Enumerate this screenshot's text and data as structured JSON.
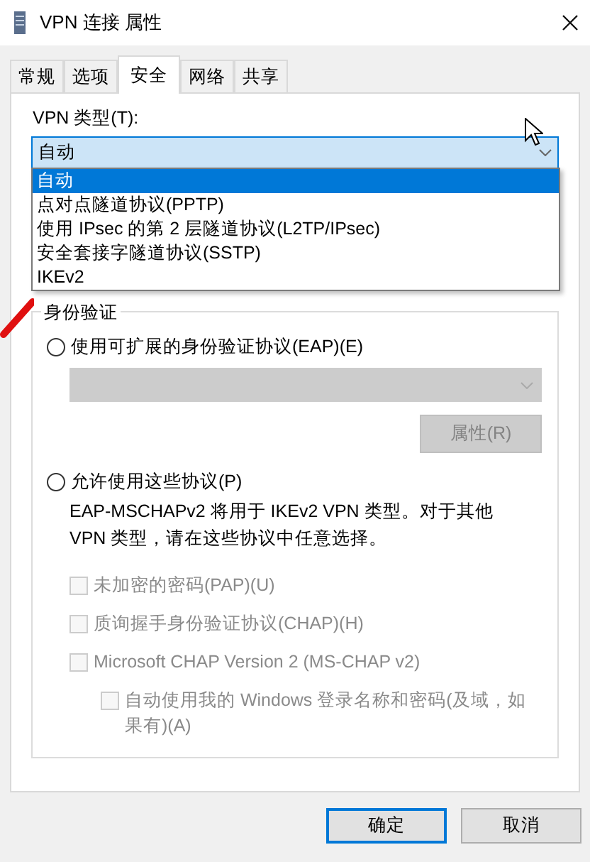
{
  "window": {
    "title": "VPN 连接 属性"
  },
  "tabs": [
    {
      "label": "常规",
      "selected": false
    },
    {
      "label": "选项",
      "selected": false
    },
    {
      "label": "安全",
      "selected": true
    },
    {
      "label": "网络",
      "selected": false
    },
    {
      "label": "共享",
      "selected": false
    }
  ],
  "vpn_type": {
    "label": "VPN 类型(T):",
    "value": "自动",
    "options": [
      {
        "label": "自动",
        "selected": true
      },
      {
        "label": "点对点隧道协议(PPTP)",
        "selected": false
      },
      {
        "label": "使用 IPsec 的第 2 层隧道协议(L2TP/IPsec)",
        "selected": false
      },
      {
        "label": "安全套接字隧道协议(SSTP)",
        "selected": false
      },
      {
        "label": "IKEv2",
        "selected": false
      }
    ]
  },
  "authentication": {
    "title": "身份验证",
    "eap": {
      "label": "使用可扩展的身份验证协议(EAP)(E)",
      "selected": false,
      "properties_button": {
        "label": "属性(R)",
        "disabled": true
      }
    },
    "protocols": {
      "label": "允许使用这些协议(P)",
      "selected": false,
      "note": "EAP-MSCHAPv2 将用于 IKEv2 VPN 类型。对于其他 VPN 类型，请在这些协议中任意选择。",
      "checkboxes": [
        {
          "label": "未加密的密码(PAP)(U)",
          "checked": false,
          "disabled": true
        },
        {
          "label": "质询握手身份验证协议(CHAP)(H)",
          "checked": false,
          "disabled": true
        },
        {
          "label": "Microsoft CHAP Version 2 (MS-CHAP v2)",
          "checked": false,
          "disabled": true,
          "children": [
            {
              "label": "自动使用我的 Windows 登录名称和密码(及域，如果有)(A)",
              "checked": false,
              "disabled": true
            }
          ]
        }
      ]
    }
  },
  "buttons": [
    {
      "label": "确定",
      "default": true
    },
    {
      "label": "取消",
      "default": false
    }
  ]
}
